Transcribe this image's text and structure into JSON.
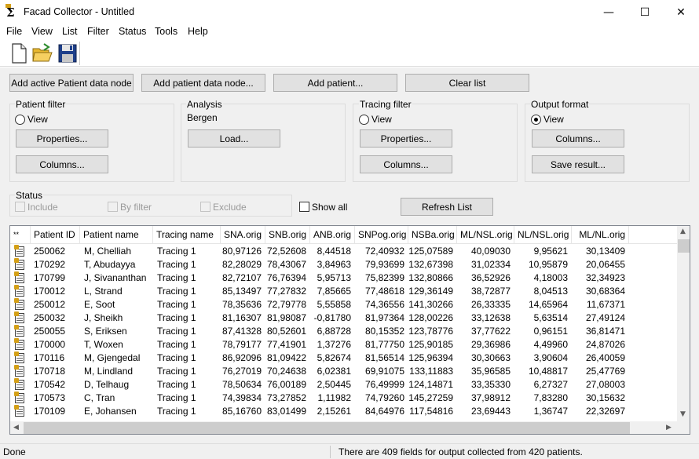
{
  "window": {
    "title": "Facad Collector - Untitled",
    "controls": {
      "minimize": "—",
      "maximize": "☐",
      "close": "✕"
    }
  },
  "menu": [
    "File",
    "View",
    "List",
    "Filter",
    "Status",
    "Tools",
    "Help"
  ],
  "toolbar": {
    "icons": [
      "new-file-icon",
      "open-folder-icon",
      "save-disk-icon"
    ]
  },
  "top_buttons": {
    "add_active": "Add active Patient data node",
    "add_node": "Add patient data node...",
    "add_patient": "Add patient...",
    "clear_list": "Clear list"
  },
  "patient_filter": {
    "label": "Patient filter",
    "view": "View",
    "properties": "Properties...",
    "columns": "Columns..."
  },
  "analysis": {
    "label": "Analysis",
    "value": "Bergen",
    "load": "Load..."
  },
  "tracing_filter": {
    "label": "Tracing filter",
    "view": "View",
    "properties": "Properties...",
    "columns": "Columns..."
  },
  "output_format": {
    "label": "Output format",
    "view": "View",
    "columns": "Columns...",
    "save": "Save result..."
  },
  "status_group": {
    "label": "Status",
    "include": "Include",
    "by_filter": "By filter",
    "exclude": "Exclude",
    "show_all": "Show all",
    "refresh": "Refresh List"
  },
  "table": {
    "columns": [
      "**",
      "Patient ID",
      "Patient name",
      "Tracing name",
      "SNA.orig",
      "SNB.orig",
      "ANB.orig",
      "SNPog.orig",
      "NSBa.orig",
      "ML/NSL.orig",
      "NL/NSL.orig",
      "ML/NL.orig"
    ],
    "rows": [
      [
        "250062",
        "M, Chelliah",
        "Tracing 1",
        "80,97126",
        "72,52608",
        "8,44518",
        "72,40932",
        "125,07589",
        "40,09030",
        "9,95621",
        "30,13409"
      ],
      [
        "170292",
        "T, Abudayya",
        "Tracing 1",
        "82,28029",
        "78,43067",
        "3,84963",
        "79,93699",
        "132,67398",
        "31,02334",
        "10,95879",
        "20,06455"
      ],
      [
        "170799",
        "J, Sivananthan",
        "Tracing 1",
        "82,72107",
        "76,76394",
        "5,95713",
        "75,82399",
        "132,80866",
        "36,52926",
        "4,18003",
        "32,34923"
      ],
      [
        "170012",
        "L, Strand",
        "Tracing 1",
        "85,13497",
        "77,27832",
        "7,85665",
        "77,48618",
        "129,36149",
        "38,72877",
        "8,04513",
        "30,68364"
      ],
      [
        "250012",
        "E, Soot",
        "Tracing 1",
        "78,35636",
        "72,79778",
        "5,55858",
        "74,36556",
        "141,30266",
        "26,33335",
        "14,65964",
        "11,67371"
      ],
      [
        "250032",
        "J, Sheikh",
        "Tracing 1",
        "81,16307",
        "81,98087",
        "-0,81780",
        "81,97364",
        "128,00226",
        "33,12638",
        "5,63514",
        "27,49124"
      ],
      [
        "250055",
        "S, Eriksen",
        "Tracing 1",
        "87,41328",
        "80,52601",
        "6,88728",
        "80,15352",
        "123,78776",
        "37,77622",
        "0,96151",
        "36,81471"
      ],
      [
        "170000",
        "T, Woxen",
        "Tracing 1",
        "78,79177",
        "77,41901",
        "1,37276",
        "81,77750",
        "125,90185",
        "29,36986",
        "4,49960",
        "24,87026"
      ],
      [
        "170116",
        "M, Gjengedal",
        "Tracing 1",
        "86,92096",
        "81,09422",
        "5,82674",
        "81,56514",
        "125,96394",
        "30,30663",
        "3,90604",
        "26,40059"
      ],
      [
        "170718",
        "M, Lindland",
        "Tracing 1",
        "76,27019",
        "70,24638",
        "6,02381",
        "69,91075",
        "133,11883",
        "35,96585",
        "10,48817",
        "25,47769"
      ],
      [
        "170542",
        "D, Telhaug",
        "Tracing 1",
        "78,50634",
        "76,00189",
        "2,50445",
        "76,49999",
        "124,14871",
        "33,35330",
        "6,27327",
        "27,08003"
      ],
      [
        "170573",
        "C, Tran",
        "Tracing 1",
        "74,39834",
        "73,27852",
        "1,11982",
        "74,79260",
        "145,27259",
        "37,98912",
        "7,83280",
        "30,15632"
      ],
      [
        "170109",
        "E, Johansen",
        "Tracing 1",
        "85,16760",
        "83,01499",
        "2,15261",
        "84,64976",
        "117,54816",
        "23,69443",
        "1,36747",
        "22,32697"
      ]
    ]
  },
  "statusbar": {
    "left": "Done",
    "right": "There are 409 fields for output collected from 420 patients."
  }
}
